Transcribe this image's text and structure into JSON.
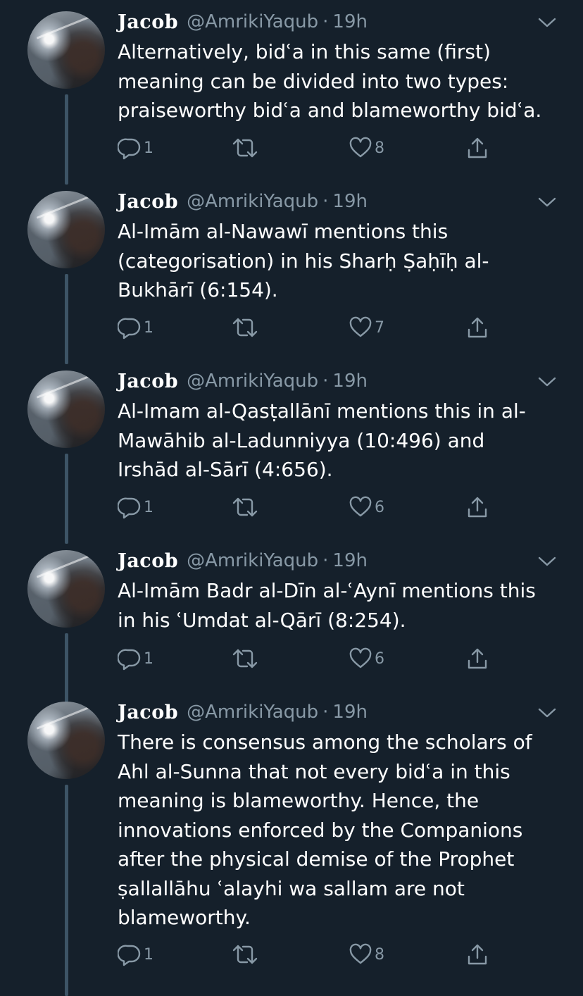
{
  "tweets": [
    {
      "name": "Jacob",
      "handle": "@AmrikiYaqub",
      "separator": "·",
      "time": "19h",
      "lines": [
        "Alternatively, bidʿa in this same (first)",
        "meaning can be divided into two types:",
        "praiseworthy bidʿa and blameworthy bidʿa."
      ],
      "replies": "1",
      "likes": "8"
    },
    {
      "name": "Jacob",
      "handle": "@AmrikiYaqub",
      "separator": "·",
      "time": "19h",
      "lines": [
        "Al-Imām al-Nawawī mentions this",
        "(categorisation) in his Sharḥ Ṣaḥīḥ al-",
        "Bukhārī (6:154)."
      ],
      "replies": "1",
      "likes": "7"
    },
    {
      "name": "Jacob",
      "handle": "@AmrikiYaqub",
      "separator": "·",
      "time": "19h",
      "lines": [
        "Al-Imam al-Qasṭallānī mentions this in al-",
        "Mawāhib al-Ladunniyya (10:496) and",
        "Irshād al-Sārī (4:656)."
      ],
      "replies": "1",
      "likes": "6"
    },
    {
      "name": "Jacob",
      "handle": "@AmrikiYaqub",
      "separator": "·",
      "time": "19h",
      "lines": [
        "Al-Imām Badr al-Dīn al-ʿAynī mentions this",
        "in his ʿUmdat al-Qārī (8:254)."
      ],
      "replies": "1",
      "likes": "6"
    },
    {
      "name": "Jacob",
      "handle": "@AmrikiYaqub",
      "separator": "·",
      "time": "19h",
      "lines": [
        "There is consensus among the scholars of",
        "Ahl al-Sunna that not every bidʿa in this",
        "meaning is blameworthy. Hence, the",
        "innovations enforced by the Companions",
        "after the physical demise of the Prophet",
        "ṣallallāhu ʿalayhi wa sallam are not",
        "blameworthy."
      ],
      "replies": "1",
      "likes": "8"
    }
  ],
  "icons": {
    "reply": "reply-icon",
    "retweet": "retweet-icon",
    "like": "heart-icon",
    "share": "share-icon",
    "menu": "chevron-down-icon"
  },
  "colors": {
    "background": "#15202b",
    "secondary_text": "#8899a6",
    "thread_line": "#3d5466"
  }
}
